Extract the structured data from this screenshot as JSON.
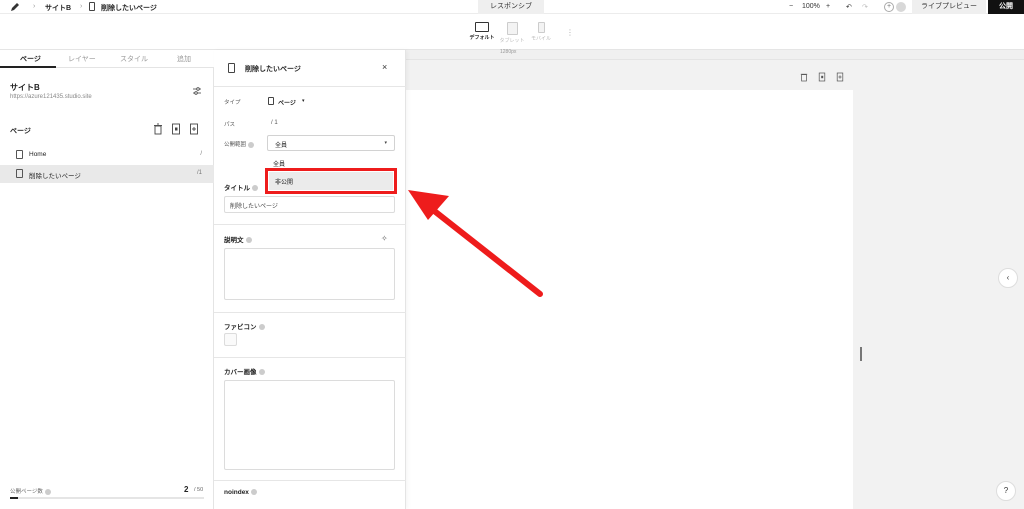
{
  "topbar": {
    "breadcrumbs": [
      "サイトB",
      "削除したいページ"
    ],
    "responsive_tab": "レスポンシブ",
    "zoom_minus": "−",
    "zoom_level": "100%",
    "zoom_plus": "+",
    "preview_label": "ライブプレビュー",
    "publish_label": "公開"
  },
  "devices": {
    "default": "デフォルト",
    "tablet": "タブレット",
    "mobile": "モバイル"
  },
  "ruler": {
    "width_label": "1280px"
  },
  "left_panel": {
    "tabs": [
      "ページ",
      "レイヤー",
      "スタイル",
      "追加"
    ],
    "site_name": "サイトB",
    "site_url": "https://azure121435.studio.site",
    "pages_heading": "ページ",
    "pages": [
      {
        "name": "Home",
        "path": "/"
      },
      {
        "name": "削除したいページ",
        "path": "/1"
      }
    ],
    "published_pages_label": "公開ページ数",
    "published_pages_count": "2",
    "published_pages_max": "/ 50",
    "published_pages_fraction": 0.04
  },
  "settings_panel": {
    "title": "削除したいページ",
    "close": "×",
    "type_label": "タイプ",
    "type_value": "ページ",
    "path_label": "パス",
    "path_value": "/ 1",
    "visibility_label": "公開範囲",
    "visibility_value": "全員",
    "visibility_options": [
      "全員",
      "非公開"
    ],
    "title_label": "タイトル",
    "title_value": "削除したいページ",
    "description_label": "説明文",
    "favicon_label": "ファビコン",
    "cover_label": "カバー画像",
    "noindex_label": "noindex"
  },
  "colors": {
    "accent_red": "#ee1c1c",
    "publish_bg": "#111111"
  },
  "canvas": {
    "collapse_icon": "‹",
    "help_icon": "?"
  }
}
